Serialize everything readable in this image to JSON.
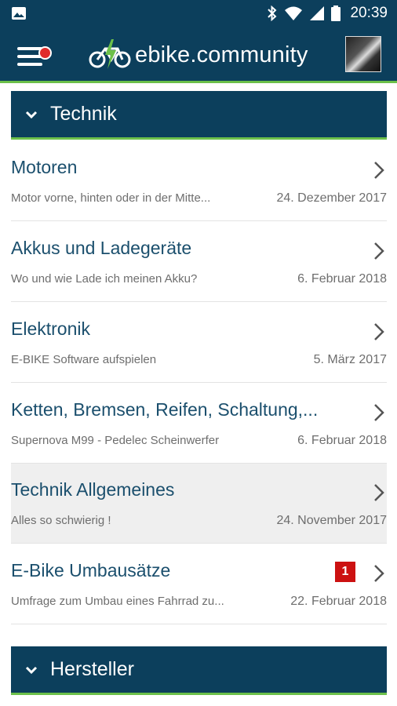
{
  "statusbar": {
    "time": "20:39"
  },
  "appbar": {
    "brand": "ebike.community",
    "notification_dot": true
  },
  "sections": [
    {
      "title": "Technik"
    },
    {
      "title": "Hersteller"
    }
  ],
  "forums": [
    {
      "title": "Motoren",
      "subtitle": "Motor vorne, hinten oder in der Mitte...",
      "date": "24. Dezember 2017"
    },
    {
      "title": "Akkus und Ladegeräte",
      "subtitle": "Wo und wie Lade ich meinen Akku?",
      "date": "6. Februar 2018"
    },
    {
      "title": "Elektronik",
      "subtitle": "E-BIKE Software aufspielen",
      "date": "5. März 2017"
    },
    {
      "title": "Ketten, Bremsen, Reifen, Schaltung,...",
      "subtitle": "Supernova M99 - Pedelec Scheinwerfer",
      "date": "6. Februar 2018"
    },
    {
      "title": "Technik Allgemeines",
      "subtitle": "Alles so schwierig !",
      "date": "24. November 2017"
    },
    {
      "title": "E-Bike Umbausätze",
      "subtitle": "Umfrage zum Umbau eines Fahrrad zu...",
      "date": "22. Februar 2018",
      "badge": "1"
    }
  ],
  "colors": {
    "primary": "#0c3f5c",
    "accent": "#6cc04a",
    "badge": "#cc1111",
    "title_text": "#1b4f6d"
  }
}
